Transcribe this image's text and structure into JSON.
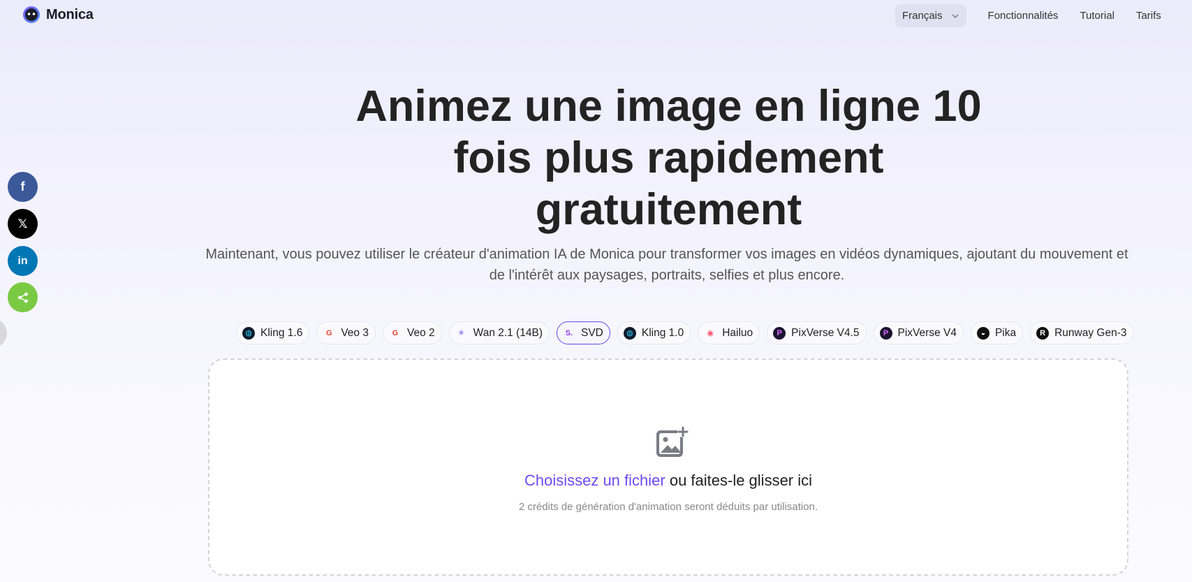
{
  "brand": {
    "name": "Monica"
  },
  "nav": {
    "language": "Français",
    "links": [
      "Fonctionnalités",
      "Tutorial",
      "Tarifs"
    ]
  },
  "social": {
    "facebook": "f",
    "x": "𝕏",
    "linkedin": "in"
  },
  "hero": {
    "title_line1": "Animez une image en ligne 10",
    "title_line2": "fois plus rapidement",
    "title_line3": "gratuitement",
    "subtitle_line1": "Maintenant, vous pouvez utiliser le créateur d'animation IA de Monica pour transformer vos images en vidéos dynamiques, ajoutant du mouvement et",
    "subtitle_line2": "de l'intérêt aux paysages, portraits, selfies et plus encore."
  },
  "models": [
    {
      "label": "Kling 1.6",
      "icon": "kling-icon",
      "icon_bg": "#0b1a2a",
      "icon_glyph": "◍"
    },
    {
      "label": "Veo 3",
      "icon": "google-icon",
      "icon_bg": "transparent",
      "icon_glyph": "G"
    },
    {
      "label": "Veo 2",
      "icon": "google-icon",
      "icon_bg": "transparent",
      "icon_glyph": "G"
    },
    {
      "label": "Wan 2.1 (14B)",
      "icon": "wan-icon",
      "icon_bg": "transparent",
      "icon_glyph": "✳"
    },
    {
      "label": "SVD",
      "icon": "svd-icon",
      "icon_bg": "transparent",
      "icon_glyph": "S."
    },
    {
      "label": "Kling 1.0",
      "icon": "kling-icon",
      "icon_bg": "#0b1a2a",
      "icon_glyph": "◍"
    },
    {
      "label": "Hailuo",
      "icon": "hailuo-icon",
      "icon_bg": "transparent",
      "icon_glyph": "◉"
    },
    {
      "label": "PixVerse V4.5",
      "icon": "pixverse-icon",
      "icon_bg": "#1d1330",
      "icon_glyph": "P"
    },
    {
      "label": "PixVerse V4",
      "icon": "pixverse-icon",
      "icon_bg": "#1d1330",
      "icon_glyph": "P"
    },
    {
      "label": "Pika",
      "icon": "pika-icon",
      "icon_bg": "#111111",
      "icon_glyph": "◒"
    },
    {
      "label": "Runway Gen-3",
      "icon": "runway-icon",
      "icon_bg": "#111111",
      "icon_glyph": "R"
    }
  ],
  "selected_model": "SVD",
  "upload": {
    "choose_link": "Choisissez un fichier",
    "drag_text": " ou faites-le glisser ici",
    "note": "2 crédits de génération d'animation seront déduits par utilisation."
  },
  "colors": {
    "accent": "#6c4cf0",
    "selected_border": "#5a4ee0",
    "facebook": "#3b5998",
    "linkedin": "#0077b5",
    "share": "#7ac943"
  }
}
